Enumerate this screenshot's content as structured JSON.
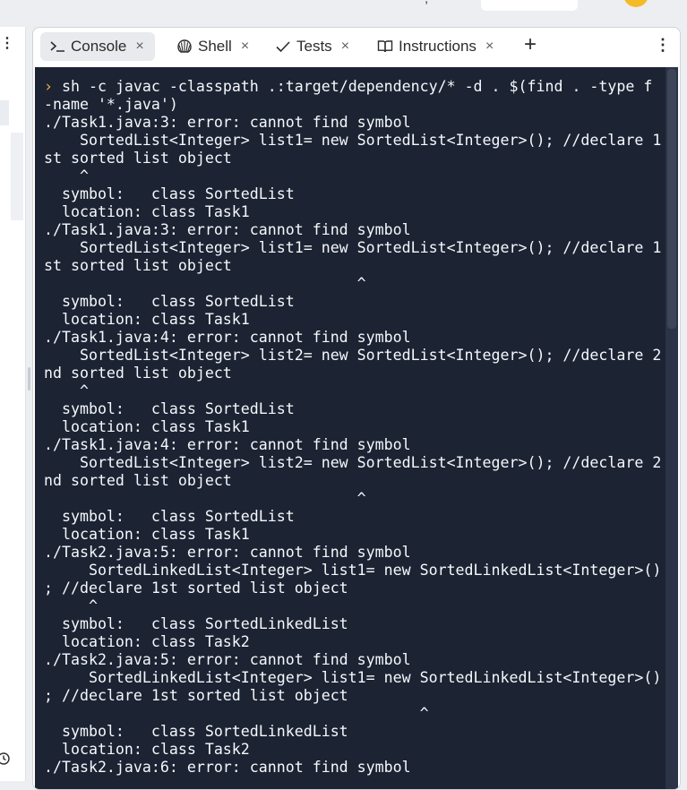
{
  "tabs": [
    {
      "label": "Console",
      "icon": "terminal-icon",
      "active": true
    },
    {
      "label": "Shell",
      "icon": "shell-icon",
      "active": false
    },
    {
      "label": "Tests",
      "icon": "check-icon",
      "active": false
    },
    {
      "label": "Instructions",
      "icon": "book-icon",
      "active": false
    }
  ],
  "tab_close_glyph": "×",
  "add_tab_glyph": "+",
  "menu_glyph": "⋮",
  "console": {
    "prompt_glyph": "›",
    "command": "sh -c javac -classpath .:target/dependency/* -d . $(find . -type f\n-name '*.java')",
    "output_lines": [
      "./Task1.java:3: error: cannot find symbol",
      "    SortedList<Integer> list1= new SortedList<Integer>(); //declare 1",
      "st sorted list object",
      "    ^",
      "  symbol:   class SortedList",
      "  location: class Task1",
      "./Task1.java:3: error: cannot find symbol",
      "    SortedList<Integer> list1= new SortedList<Integer>(); //declare 1",
      "st sorted list object",
      "                                   ^",
      "  symbol:   class SortedList",
      "  location: class Task1",
      "./Task1.java:4: error: cannot find symbol",
      "    SortedList<Integer> list2= new SortedList<Integer>(); //declare 2",
      "nd sorted list object",
      "    ^",
      "  symbol:   class SortedList",
      "  location: class Task1",
      "./Task1.java:4: error: cannot find symbol",
      "    SortedList<Integer> list2= new SortedList<Integer>(); //declare 2",
      "nd sorted list object",
      "                                   ^",
      "  symbol:   class SortedList",
      "  location: class Task1",
      "./Task2.java:5: error: cannot find symbol",
      "     SortedLinkedList<Integer> list1= new SortedLinkedList<Integer>()",
      "; //declare 1st sorted list object",
      "     ^",
      "  symbol:   class SortedLinkedList",
      "  location: class Task2",
      "./Task2.java:5: error: cannot find symbol",
      "     SortedLinkedList<Integer> list1= new SortedLinkedList<Integer>()",
      "; //declare 1st sorted list object",
      "                                          ^",
      "  symbol:   class SortedLinkedList",
      "  location: class Task2",
      "./Task2.java:6: error: cannot find symbol"
    ]
  },
  "colors": {
    "console_bg": "#1c2333",
    "console_text": "#f5f9fc",
    "prompt": "#f2b33d",
    "active_tab_bg": "#e8eaee",
    "avatar": "#f4bb26"
  }
}
